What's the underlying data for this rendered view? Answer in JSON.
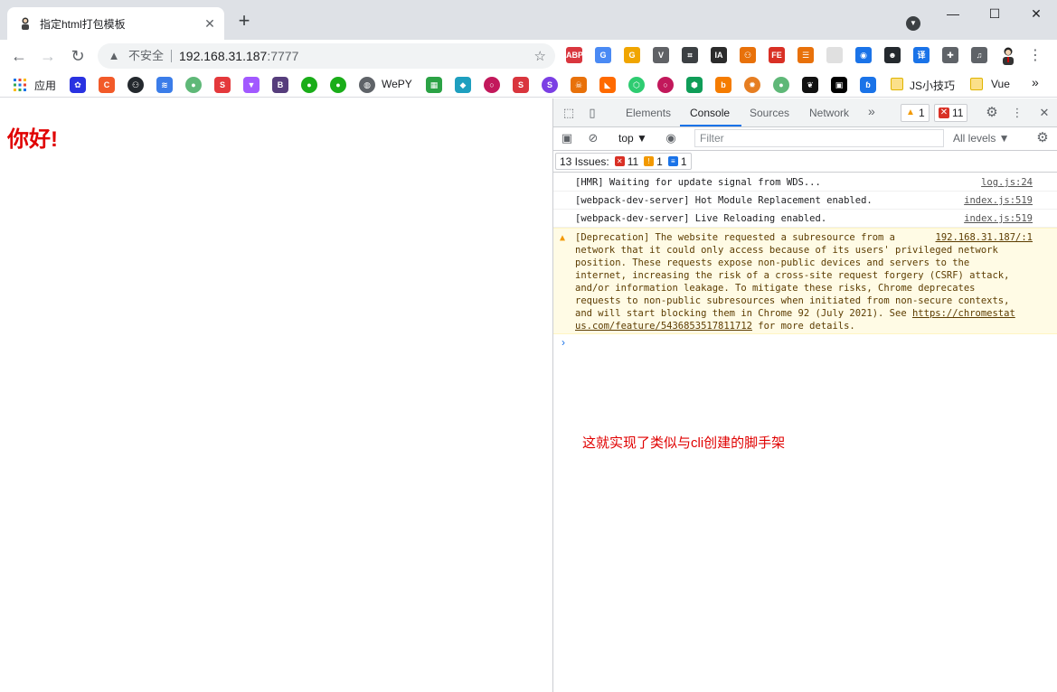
{
  "tab": {
    "title": "指定html打包模板"
  },
  "address": {
    "security_label": "不安全",
    "host": "192.168.31.187",
    "port": ":7777"
  },
  "extensions": [
    {
      "name": "abp",
      "label": "ABP",
      "color": "#d9363e"
    },
    {
      "name": "translate",
      "label": "G",
      "color": "#4a8af4"
    },
    {
      "name": "grammarly",
      "label": "G",
      "color": "#f0a500"
    },
    {
      "name": "vue-devtools",
      "label": "V",
      "color": "#606266"
    },
    {
      "name": "screenshot",
      "label": "⌗",
      "color": "#3c4043"
    },
    {
      "name": "ia",
      "label": "IA",
      "color": "#2b2b2b"
    },
    {
      "name": "network",
      "label": "⚇",
      "color": "#e8710a"
    },
    {
      "name": "fe",
      "label": "FE",
      "color": "#d93025"
    },
    {
      "name": "reader",
      "label": "☰",
      "color": "#e8710a"
    },
    {
      "name": "blank",
      "label": "",
      "color": "#e0e0e0"
    },
    {
      "name": "colorpicker",
      "label": "◉",
      "color": "#1a73e8"
    },
    {
      "name": "octotree",
      "label": "☻",
      "color": "#24292e"
    },
    {
      "name": "yi",
      "label": "译",
      "color": "#1a73e8"
    },
    {
      "name": "puzzle",
      "label": "✚",
      "color": "#5f6368"
    },
    {
      "name": "playlist",
      "label": "♫",
      "color": "#5f6368"
    }
  ],
  "bookmarks": {
    "apps_label": "应用",
    "wepy_label": "WePY",
    "jstips_label": "JS小技巧",
    "vue_label": "Vue",
    "more": "»"
  },
  "page": {
    "heading": "你好!"
  },
  "devtools": {
    "tabs": [
      "Elements",
      "Console",
      "Sources",
      "Network"
    ],
    "more_tabs": "»",
    "warn_count": "1",
    "error_count": "11",
    "context": "top ▼",
    "filter_placeholder": "Filter",
    "levels": "All levels ▼",
    "issues": {
      "label": "13 Issues:",
      "errors": "11",
      "warnings": "1",
      "info": "1"
    }
  },
  "console": [
    {
      "text": "[HMR] Waiting for update signal from WDS...",
      "source": "log.js:24"
    },
    {
      "text": "[webpack-dev-server] Hot Module Replacement enabled.",
      "source": "index.js:519"
    },
    {
      "text": "[webpack-dev-server] Live Reloading enabled.",
      "source": "index.js:519"
    }
  ],
  "warning": {
    "source": "192.168.31.187/:1",
    "lines": [
      "[Deprecation] The website requested a subresource from a",
      "network that it could only access because of its users' privileged network",
      "position. These requests expose non-public devices and servers to the",
      "internet, increasing the risk of a cross-site request forgery (CSRF) attack,",
      "and/or information leakage. To mitigate these risks, Chrome deprecates",
      "requests to non-public subresources when initiated from non-secure contexts,",
      "and will start blocking them in Chrome 92 (July 2021). See "
    ],
    "link_part1": "https://chromestat",
    "link_part2": "us.com/feature/5436853517811712",
    "tail": " for more details."
  },
  "annotation": "这就实现了类似与cli创建的脚手架"
}
